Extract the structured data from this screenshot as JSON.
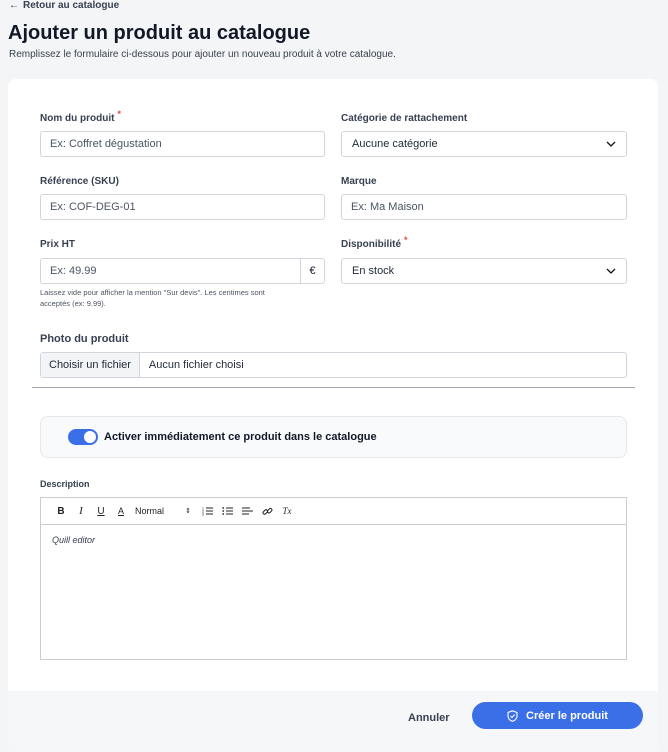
{
  "header": {
    "back_label": "Retour au catalogue",
    "title": "Ajouter un produit au catalogue",
    "subtitle": "Remplissez le formulaire ci-dessous pour ajouter un nouveau produit à votre catalogue."
  },
  "form": {
    "name": {
      "label": "Nom du produit",
      "required_mark": "*",
      "placeholder": "Ex: Coffret dégustation"
    },
    "category": {
      "label": "Catégorie de rattachement",
      "value": "Aucune catégorie"
    },
    "sku": {
      "label": "Référence (SKU)",
      "placeholder": "Ex: COF-DEG-01"
    },
    "brand": {
      "label": "Marque",
      "placeholder": "Ex: Ma Maison"
    },
    "price": {
      "label": "Prix HT",
      "placeholder": "Ex: 49.99",
      "currency": "€",
      "hint_line1": "Laissez vide pour afficher la mention \"Sur devis\". Les centimes sont",
      "hint_line2": "acceptés (ex: 9.99)."
    },
    "availability": {
      "label": "Disponibilité",
      "required_mark": "*",
      "value": "En stock"
    },
    "photo": {
      "label": "Photo du produit",
      "button": "Choisir un fichier",
      "status": "Aucun fichier choisi"
    },
    "activate": {
      "label": "Activer immédiatement ce produit dans le catalogue",
      "on": true,
      "accent": "#3b6fe8"
    },
    "description": {
      "label": "Description",
      "toolbar": {
        "bold": "B",
        "italic": "I",
        "underline": "U",
        "color": "A",
        "size": "Normal",
        "clean": "Tx"
      },
      "content": "Quill editor"
    }
  },
  "footer": {
    "cancel_label": "Annuler",
    "submit_label": "Créer le produit",
    "submit_color": "#3b6fe8"
  }
}
